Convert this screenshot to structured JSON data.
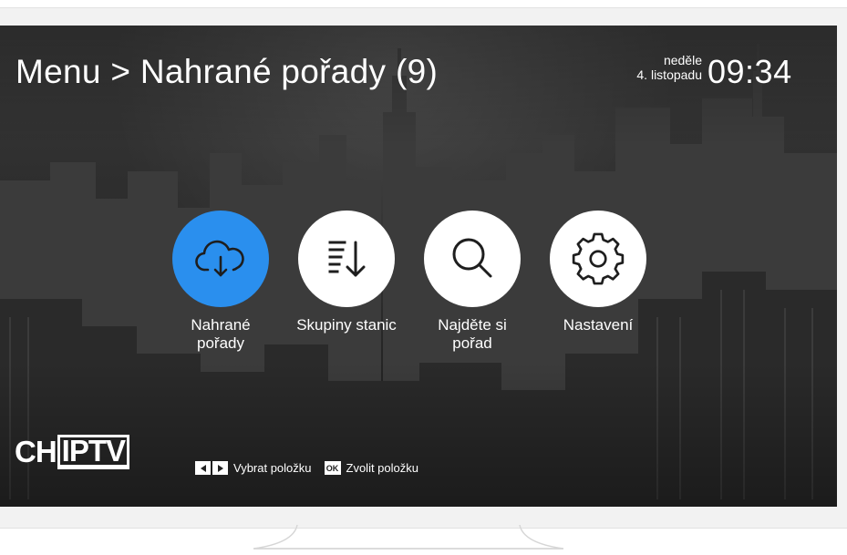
{
  "header": {
    "title": "Menu > Nahrané pořady (9)",
    "day": "neděle",
    "date": "4. listopadu",
    "time": "09:34"
  },
  "menu": {
    "items": [
      {
        "label_line1": "Nahrané",
        "label_line2": "pořady",
        "icon": "cloud-download-icon",
        "active": true
      },
      {
        "label_line1": "Skupiny stanic",
        "label_line2": "",
        "icon": "sort-list-icon",
        "active": false
      },
      {
        "label_line1": "Najděte si",
        "label_line2": "pořad",
        "icon": "search-icon",
        "active": false
      },
      {
        "label_line1": "Nastavení",
        "label_line2": "",
        "icon": "gear-icon",
        "active": false
      }
    ]
  },
  "logo": {
    "part1": "CH",
    "part2": "IPTV"
  },
  "hints": {
    "select_label": "Vybrat položku",
    "ok_key": "OK",
    "confirm_label": "Zvolit položku"
  },
  "colors": {
    "accent": "#2a8fee",
    "text": "#ffffff",
    "icon": "#1e1e1e"
  }
}
